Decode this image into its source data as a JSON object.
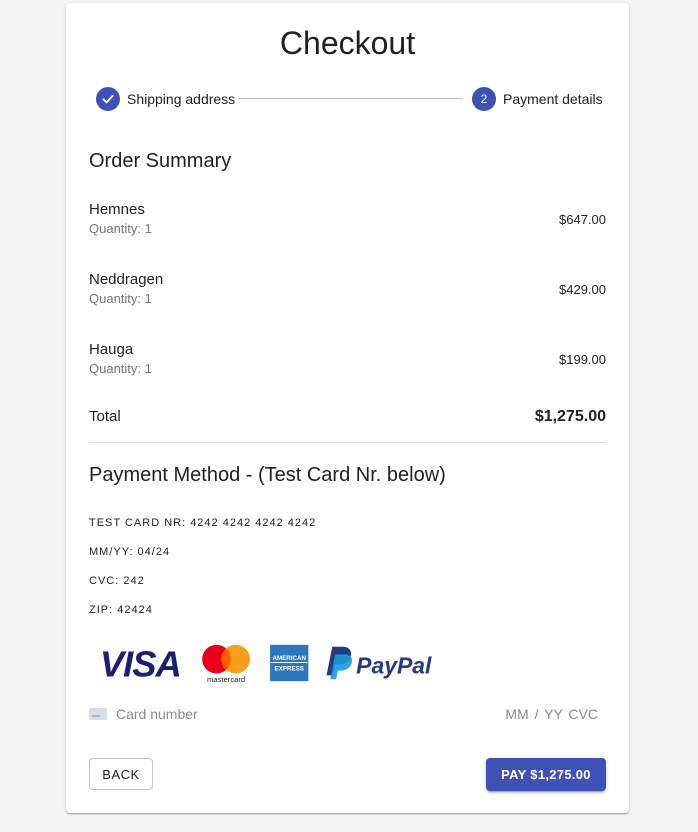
{
  "title": "Checkout",
  "stepper": {
    "steps": [
      {
        "label": "Shipping address",
        "state": "completed",
        "icon": "check-icon"
      },
      {
        "label": "Payment details",
        "state": "active",
        "number": "2"
      }
    ]
  },
  "order_summary": {
    "title": "Order Summary",
    "items": [
      {
        "name": "Hemnes",
        "quantity": "Quantity: 1",
        "price": "$647.00"
      },
      {
        "name": "Neddragen",
        "quantity": "Quantity: 1",
        "price": "$429.00"
      },
      {
        "name": "Hauga",
        "quantity": "Quantity: 1",
        "price": "$199.00"
      }
    ],
    "total_label": "Total",
    "total_value": "$1,275.00"
  },
  "payment": {
    "title": "Payment Method - (Test Card Nr. below)",
    "test_lines": [
      "TEST CARD NR: 4242 4242 4242 4242",
      "MM/YY: 04/24",
      "CVC: 242",
      "ZIP: 42424"
    ],
    "brands": [
      "visa-logo",
      "mastercard-logo",
      "american-express-logo",
      "paypal-logo"
    ],
    "brand_text": {
      "visa": "VISA",
      "mastercard": "mastercard",
      "amex_top": "AMERICAN",
      "amex_bottom": "EXPRESS",
      "paypal": "PayPal"
    },
    "card_field": {
      "placeholder": "Card number",
      "expiry_cvc_placeholder": "MM / YY  CVC"
    }
  },
  "actions": {
    "back_label": "BACK",
    "pay_label": "PAY $1,275.00"
  },
  "colors": {
    "primary": "#3f51b5",
    "visa_blue": "#1a1f71",
    "mastercard_red": "#eb001b",
    "mastercard_yellow": "#f79e1b",
    "amex_blue": "#2e77bc",
    "paypal_dark": "#253b80",
    "paypal_light": "#179bd7"
  }
}
